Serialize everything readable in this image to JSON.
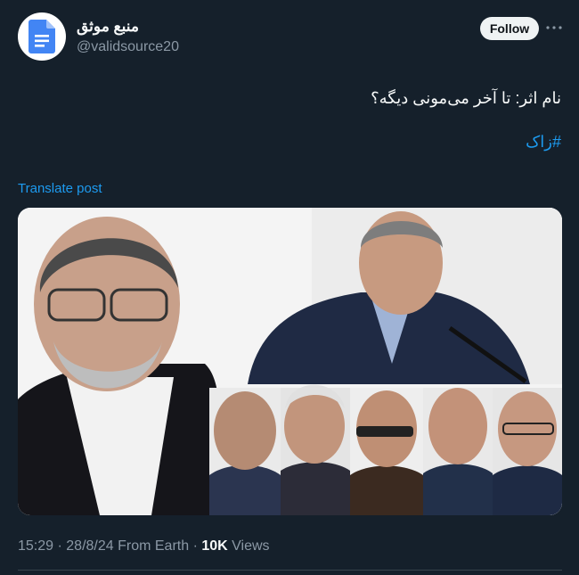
{
  "author": {
    "display_name": "منبع موثق",
    "handle": "@validsource20",
    "avatar_icon": "document-icon"
  },
  "header": {
    "follow_label": "Follow",
    "more_icon": "more-options-icon"
  },
  "tweet": {
    "text": "نام اثر: تا آخر می‌مونی دیگه؟",
    "hashtag": "#زاک",
    "translate_label": "Translate post"
  },
  "media": {
    "type": "photo-collage"
  },
  "meta": {
    "time": "15:29",
    "separator": " · ",
    "date": "28/8/24",
    "source": "From Earth",
    "views_count": "10K",
    "views_label": "Views"
  },
  "colors": {
    "background": "#15202b",
    "accent": "#1d9bf0",
    "text_primary": "#f7f9f9",
    "text_secondary": "#8b98a5"
  }
}
